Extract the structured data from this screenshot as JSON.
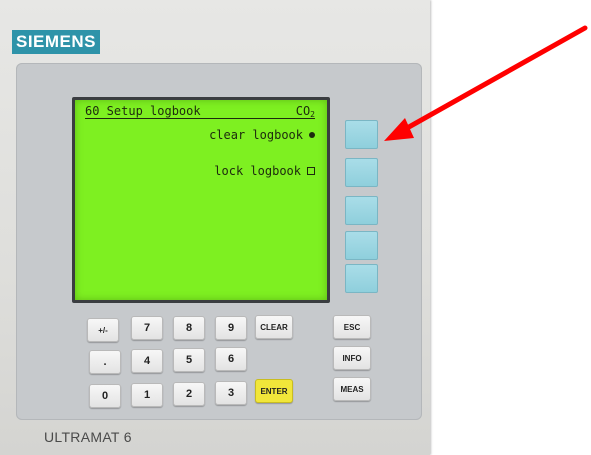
{
  "brand": "SIEMENS",
  "model": "ULTRAMAT 6",
  "display": {
    "title": "60 Setup logbook",
    "gas_main": "CO",
    "gas_sub": "2",
    "menu": [
      {
        "label": "clear logbook",
        "indicator": "dot"
      },
      {
        "label": "lock logbook",
        "indicator": "box"
      }
    ]
  },
  "keys": {
    "plusminus": "+/-",
    "seven": "7",
    "eight": "8",
    "nine": "9",
    "clear": "CLEAR",
    "dot": ".",
    "four": "4",
    "five": "5",
    "six": "6",
    "zero": "0",
    "one": "1",
    "two": "2",
    "three": "3",
    "enter": "ENTER",
    "esc": "ESC",
    "info": "INFO",
    "meas": "MEAS"
  },
  "colors": {
    "lcd": "#7ef021",
    "softkey": "#9fd8e4",
    "enter_key": "#f1e63a",
    "annotation_arrow": "#ff0000",
    "brand": "#2e93a9"
  }
}
